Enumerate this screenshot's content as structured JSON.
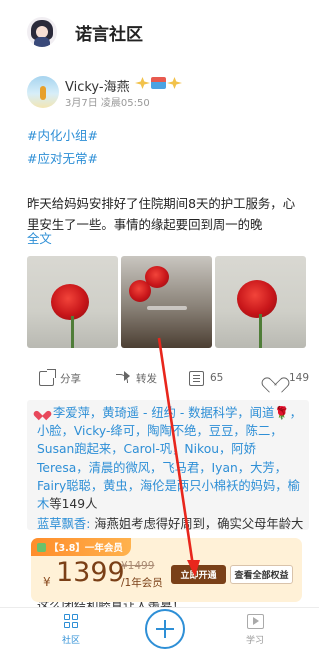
{
  "app": {
    "title": "诺言社区"
  },
  "post": {
    "author": "Vicky-海燕",
    "time": "3月7日 凌晨05:50",
    "tags": [
      "#内化小组#",
      "#应对无常#"
    ],
    "content": "昨天给妈妈安排好了住院期间8天的护工服务，心里安生了一些。事情的缘起要回到周一的晚",
    "more_link": "全文"
  },
  "actions": {
    "share": "分享",
    "forward": "转发",
    "comments": "65",
    "likes": "149"
  },
  "likers": {
    "names": "李爱萍，黄琦遥 - 纽约 - 数据科学，闻道🌹，小脸，Vicky-绛可，陶陶不绝，豆豆，陈二，Susan跑起来，Carol-巩，Nikou，阿娇Teresa，清晨的微风，飞马君，Iyan，大芳，Fairy聪聪，黄虫，海伦是两只小棉袄的妈妈，榆木",
    "suffix": "等149人"
  },
  "comment": {
    "author": "蓝草飘香:",
    "text": " 海燕姐考虑得好周到，确实父母年龄大了，医护保障都要跟上，祝海燕姐",
    "next_line": "这么团结和睦真让人羡慕！"
  },
  "banner": {
    "tag": "【3.8】一年会员",
    "currency": "¥",
    "price": "1399",
    "old_price": "¥1499",
    "per": "/1年会员",
    "buy_label": "立即开通",
    "all_label": "查看全部权益"
  },
  "tabbar": {
    "home": "社区",
    "learn": "学习"
  },
  "colors": {
    "accent": "#2e8fd6",
    "banner_bg": "#fff1d7",
    "price": "#7a3f16",
    "arrow": "#e8261c"
  }
}
